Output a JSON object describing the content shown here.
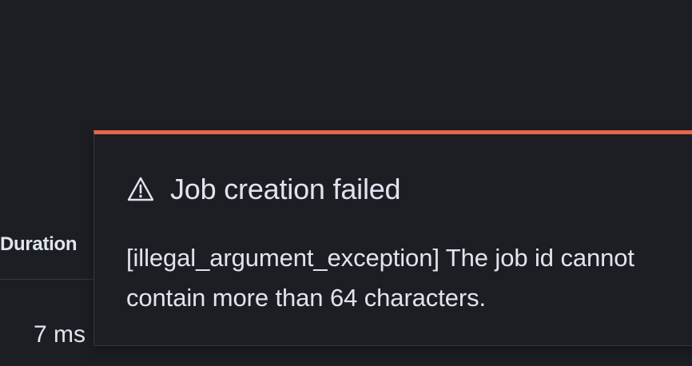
{
  "background_table": {
    "column_header": "Duration",
    "cell_value": "7 ms"
  },
  "toast": {
    "icon": "warning-icon",
    "title": "Job creation failed",
    "message": "[illegal_argument_exception] The job id cannot contain more than 64 characters.",
    "accent_color": "#e7664c"
  }
}
